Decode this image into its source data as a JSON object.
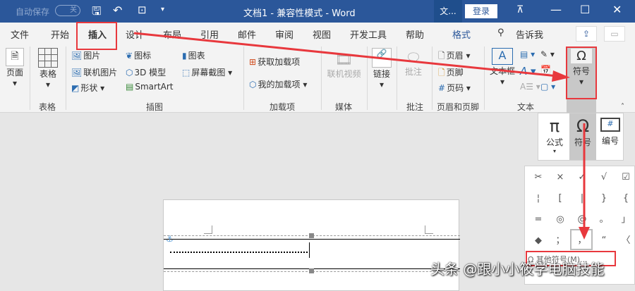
{
  "titlebar": {
    "autosave": "自动保存",
    "autosave_state": "关",
    "title": "文档1 - 兼容性模式 - Word",
    "account_short": "文...",
    "login": "登录"
  },
  "tabs": [
    "文件",
    "开始",
    "插入",
    "设计",
    "布局",
    "引用",
    "邮件",
    "审阅",
    "视图",
    "开发工具",
    "帮助",
    "格式"
  ],
  "tell_me": "告诉我",
  "ribbon": {
    "page": "页面",
    "table": "表格",
    "group_table": "表格",
    "picture": "图片",
    "online_picture": "联机图片",
    "shapes": "形状",
    "icons": "图标",
    "model3d": "3D 模型",
    "smartart": "SmartArt",
    "chart": "图表",
    "screenshot": "屏幕截图",
    "group_illustrations": "插图",
    "get_addins": "获取加载项",
    "my_addins": "我的加载项",
    "group_addins": "加载项",
    "online_video": "联机视频",
    "group_media": "媒体",
    "link": "链接",
    "comment": "批注",
    "group_comment": "批注",
    "header": "页眉",
    "footer": "页脚",
    "page_number": "页码",
    "group_headerfooter": "页眉和页脚",
    "textbox": "文本框",
    "group_text": "文本",
    "symbol": "符号"
  },
  "panel": {
    "equation": "公式",
    "symbol": "符号",
    "number": "编号",
    "symbols": [
      "✂",
      "×",
      "✓",
      "√",
      "☑",
      "¦",
      "[",
      "|",
      "}",
      "{",
      "=",
      "◎",
      "@",
      "。",
      "」",
      "◆",
      "；",
      "，",
      "“",
      "〈"
    ],
    "more": "其他符号(M)..."
  },
  "watermark": "头条 @跟小小筱学电脑技能",
  "colors": {
    "title_blue": "#2b579a",
    "annotation_red": "#e8383d"
  }
}
